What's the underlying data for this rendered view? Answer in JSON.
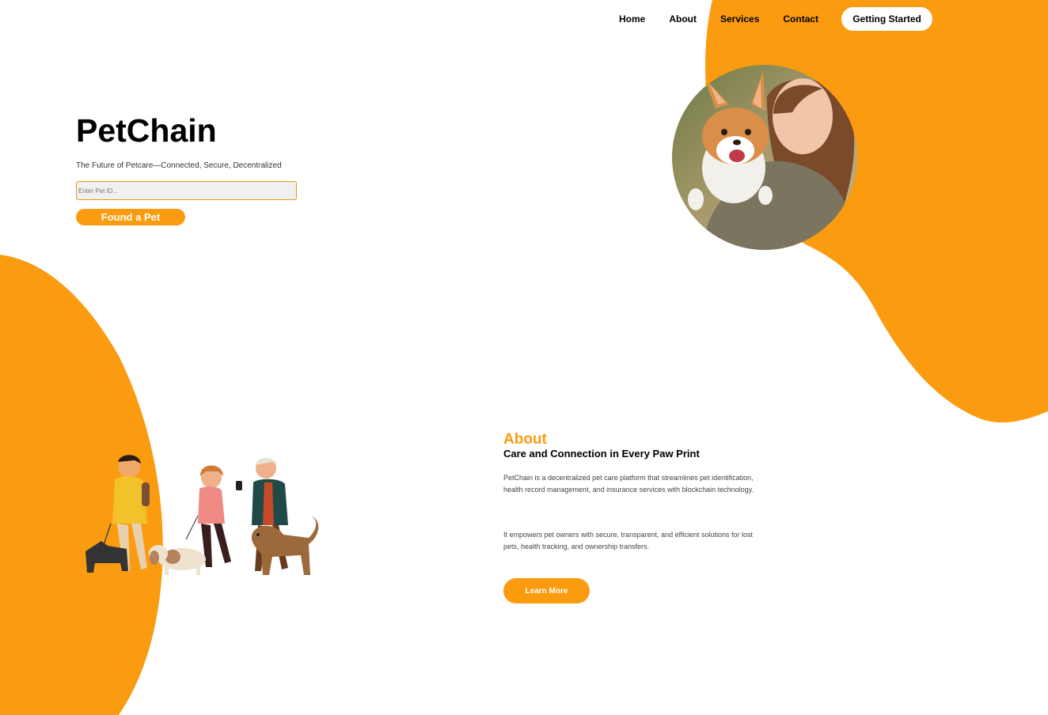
{
  "nav": {
    "items": [
      {
        "label": "Home"
      },
      {
        "label": "About"
      },
      {
        "label": "Services"
      },
      {
        "label": "Contact"
      }
    ],
    "cta_label": "Getting Started"
  },
  "hero": {
    "title": "PetChain",
    "subtitle": "The Future of Petcare—Connected, Secure, Decentralized",
    "input_placeholder": "Enter Pet ID...",
    "input_value": "",
    "button_label": "Found a Pet"
  },
  "about": {
    "heading": "About",
    "subheading": "Care and Connection in Every Paw Print",
    "paragraph1": "PetChain is a decentralized pet care platform that streamlines pet identification, health record management, and insurance services with blockchain technology.",
    "paragraph2": "It empowers pet owners with secure, transparent, and efficient solutions for lost pets, health tracking, and ownership transfers.",
    "button_label": "Learn More"
  },
  "colors": {
    "accent": "#fb9b0f",
    "text": "#000000",
    "background": "#ffffff"
  }
}
